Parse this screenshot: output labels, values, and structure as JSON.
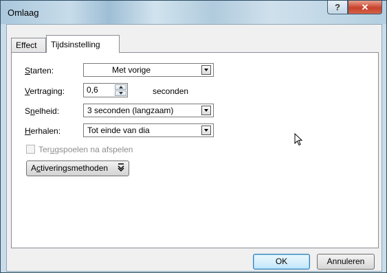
{
  "window": {
    "title": "Omlaag",
    "help_label": "?",
    "close_label": "✕"
  },
  "tabs": [
    {
      "label": "Effect",
      "active": false
    },
    {
      "label": "Tijdsinstelling",
      "active": true
    }
  ],
  "form": {
    "start": {
      "label_u": "S",
      "label_rest": "tarten:",
      "value": "Met vorige"
    },
    "delay": {
      "label_u": "V",
      "label_rest": "ertraging:",
      "value": "0,6",
      "unit": "seconden"
    },
    "speed": {
      "label_pre": "S",
      "label_u": "n",
      "label_rest": "elheid:",
      "value": "3 seconden (langzaam)"
    },
    "repeat": {
      "label_u": "H",
      "label_rest": "erhalen:",
      "value": "Tot einde van dia"
    },
    "rewind": {
      "label_pre": "Ter",
      "label_u": "u",
      "label_rest": "gspoelen na afspelen",
      "checked": false,
      "disabled": true
    },
    "triggers": {
      "label_pre": "A",
      "label_u": "c",
      "label_rest": "tiveringsmethoden",
      "icon": "double-chevron-down-icon"
    }
  },
  "buttons": {
    "ok": "OK",
    "cancel": "Annuleren"
  },
  "colors": {
    "titlebar": "#b7d2e5",
    "close_button": "#c7422a",
    "ok_button_border": "#3c7fb1"
  }
}
